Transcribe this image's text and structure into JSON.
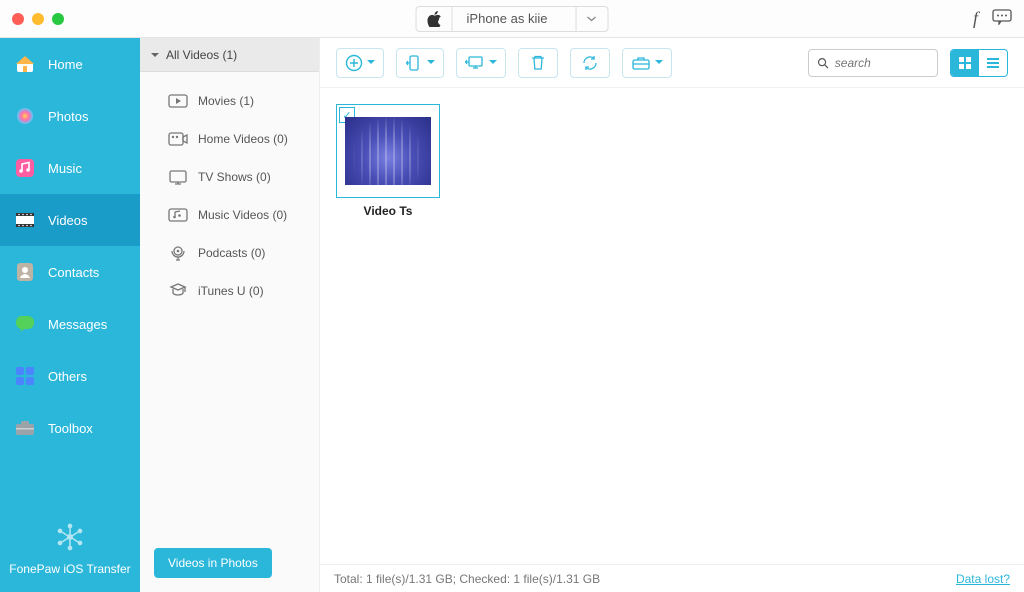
{
  "titlebar": {
    "device_name": "iPhone as kiie"
  },
  "sidebar": {
    "items": [
      {
        "label": "Home",
        "icon": "home",
        "bg": "#ffb648"
      },
      {
        "label": "Photos",
        "icon": "photos",
        "bg": "#ff6fae"
      },
      {
        "label": "Music",
        "icon": "music",
        "bg": "#ff82c0"
      },
      {
        "label": "Videos",
        "icon": "videos",
        "bg": "#ffffff"
      },
      {
        "label": "Contacts",
        "icon": "contacts",
        "bg": "#c9c0b6"
      },
      {
        "label": "Messages",
        "icon": "messages",
        "bg": "#54d158"
      },
      {
        "label": "Others",
        "icon": "others",
        "bg": "#4a84ff"
      },
      {
        "label": "Toolbox",
        "icon": "toolbox",
        "bg": "#a8b0b6"
      }
    ],
    "active_index": 3,
    "brand": "FonePaw iOS Transfer"
  },
  "categories": {
    "header": "All Videos (1)",
    "items": [
      {
        "label": "Movies (1)"
      },
      {
        "label": "Home Videos (0)"
      },
      {
        "label": "TV Shows (0)"
      },
      {
        "label": "Music Videos (0)"
      },
      {
        "label": "Podcasts (0)"
      },
      {
        "label": "iTunes U (0)"
      }
    ],
    "footer_button": "Videos in Photos"
  },
  "toolbar": {
    "search_placeholder": "search"
  },
  "grid": {
    "items": [
      {
        "label": "Video Ts",
        "checked": true
      }
    ]
  },
  "statusbar": {
    "text": "Total: 1 file(s)/1.31 GB; Checked: 1 file(s)/1.31 GB",
    "link": "Data lost?"
  }
}
